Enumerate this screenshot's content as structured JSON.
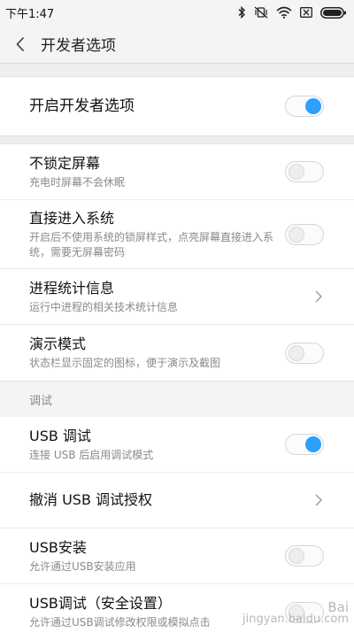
{
  "status_bar": {
    "time": "下午1:47",
    "icons": [
      "bluetooth-icon",
      "vibrate-off-icon",
      "wifi-icon",
      "sim-off-icon",
      "battery-icon"
    ]
  },
  "header": {
    "title": "开发者选项",
    "back_icon": "chevron-left-icon"
  },
  "main_toggle": {
    "title": "开启开发者选项",
    "enabled": true
  },
  "general": [
    {
      "title": "不锁定屏幕",
      "subtitle": "充电时屏幕不会休眠",
      "control": "toggle",
      "enabled": false
    },
    {
      "title": "直接进入系统",
      "subtitle": "开启后不使用系统的锁屏样式，点亮屏幕直接进入系统，需要无屏幕密码",
      "control": "toggle",
      "enabled": false
    },
    {
      "title": "进程统计信息",
      "subtitle": "运行中进程的相关技术统计信息",
      "control": "chevron"
    },
    {
      "title": "演示模式",
      "subtitle": "状态栏显示固定的图标，便于演示及截图",
      "control": "toggle",
      "enabled": false
    }
  ],
  "debug_section": {
    "label": "调试",
    "items": [
      {
        "title": "USB 调试",
        "subtitle": "连接 USB 后启用调试模式",
        "control": "toggle",
        "enabled": true
      },
      {
        "title": "撤消 USB 调试授权",
        "subtitle": "",
        "control": "chevron"
      },
      {
        "title": "USB安装",
        "subtitle": "允许通过USB安装应用",
        "control": "toggle",
        "enabled": false
      },
      {
        "title": "USB调试（安全设置）",
        "subtitle": "允许通过USB调试修改权限或模拟点击",
        "control": "toggle",
        "enabled": false
      }
    ]
  },
  "watermark": {
    "line1": "Bai",
    "line2": "jingyan.baidu.com"
  },
  "colors": {
    "accent": "#2d9fff",
    "background": "#f4f4f4",
    "card": "#ffffff"
  }
}
